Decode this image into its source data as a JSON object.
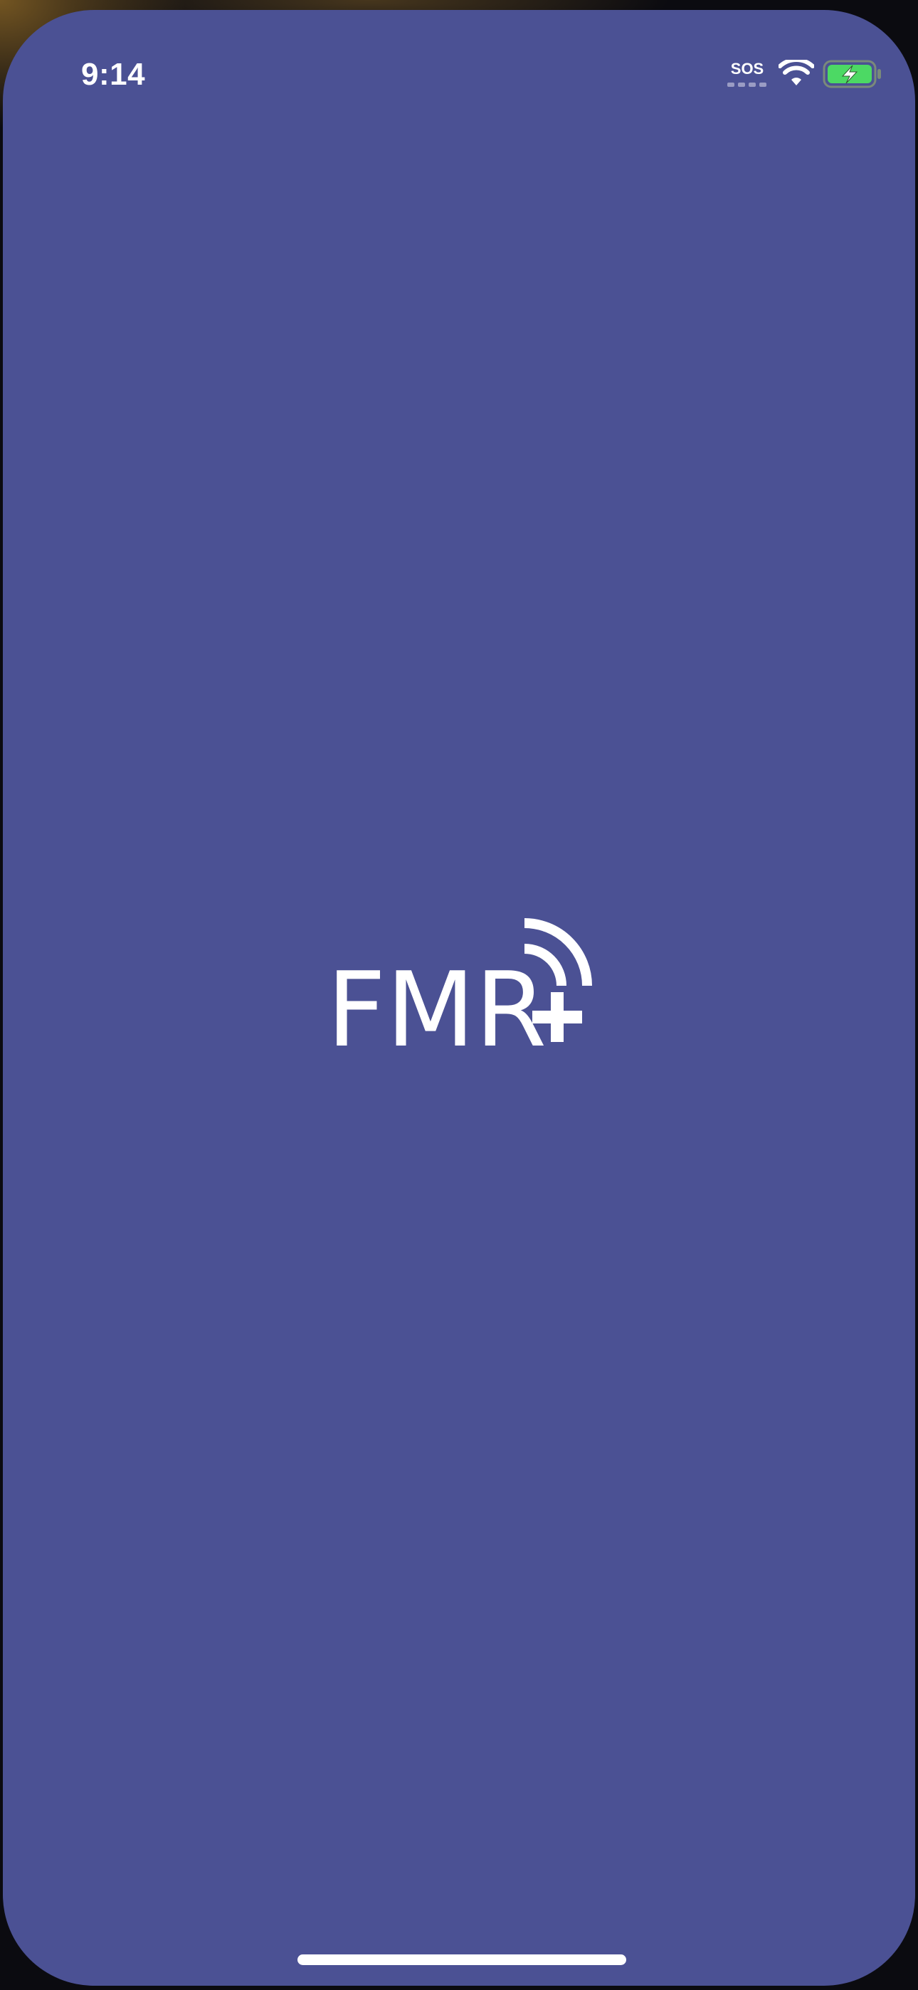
{
  "status_bar": {
    "time": "9:14",
    "sos_label": "SOS",
    "wifi_icon": "wifi-icon",
    "battery_icon": "battery-charging-icon",
    "battery_color": "#4cd964"
  },
  "splash": {
    "logo_text": "FMR",
    "logo_icon": "signal-plus-icon",
    "background_color": "#4b5194"
  }
}
